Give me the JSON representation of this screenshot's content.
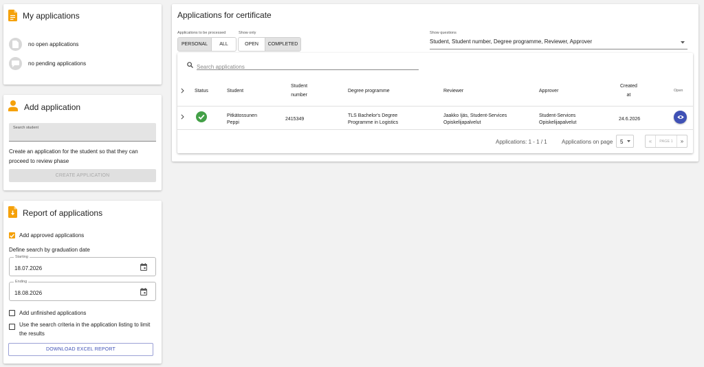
{
  "my_applications": {
    "title": "My applications",
    "open_status": "no open applications",
    "pending_status": "no pending applications"
  },
  "add_application": {
    "title": "Add application",
    "search_label": "Search student",
    "description": "Create an application for the student so that they can proceed to review phase",
    "create_button": "CREATE APPLICATION"
  },
  "report": {
    "title": "Report of applications",
    "add_approved_label": "Add approved applications",
    "add_approved_checked": true,
    "graduation_text": "Define search by graduation date",
    "starting_label": "Starting",
    "starting_value": "18.07.2026",
    "ending_label": "Ending",
    "ending_value": "18.08.2026",
    "add_unfinished_label": "Add unfinished applications",
    "add_unfinished_checked": false,
    "use_criteria_label": "Use the search criteria in the application listing to limit the results",
    "use_criteria_checked": false,
    "download_button": "DOWNLOAD EXCEL REPORT"
  },
  "main": {
    "title": "Applications for certificate",
    "processed_label": "Applications to be processed",
    "processed_options": [
      "PERSONAL",
      "ALL"
    ],
    "processed_selected": "PERSONAL",
    "show_only_label": "Show only",
    "show_only_options": [
      "OPEN",
      "COMPLETED"
    ],
    "show_only_selected": "COMPLETED",
    "show_questions_label": "Show questions",
    "show_questions_value": "Student, Student number, Degree programme, Reviewer, Approver",
    "search_placeholder": "Search applications",
    "columns": {
      "status": "Status",
      "student": "Student",
      "student_number_1": "Student",
      "student_number_2": "number",
      "degree_programme": "Degree programme",
      "reviewer": "Reviewer",
      "approver": "Approver",
      "created_1": "Created",
      "created_2": "at",
      "open": "Open"
    },
    "rows": [
      {
        "status": "completed",
        "student_line1": "Pitkätossunen",
        "student_line2": "Peppi",
        "student_number": "2415349",
        "degree_line1": "TLS Bachelor's Degree",
        "degree_line2": "Programme in Logistics",
        "reviewer_line1": "Jaakko Ijäs, Student-Services",
        "reviewer_line2": "Opiskelijapalvelut",
        "approver_line1": "Student-Services",
        "approver_line2": "Opiskelijapalvelut",
        "created": "24.6.2026"
      }
    ],
    "footer": {
      "range_text": "Applications: 1 - 1 / 1",
      "per_page_label": "Applications on page",
      "per_page_value": "5",
      "page_text": "PAGE 1"
    }
  },
  "colors": {
    "accent": "#f5a10a",
    "primary": "#3f51b5",
    "success": "#43a047"
  }
}
